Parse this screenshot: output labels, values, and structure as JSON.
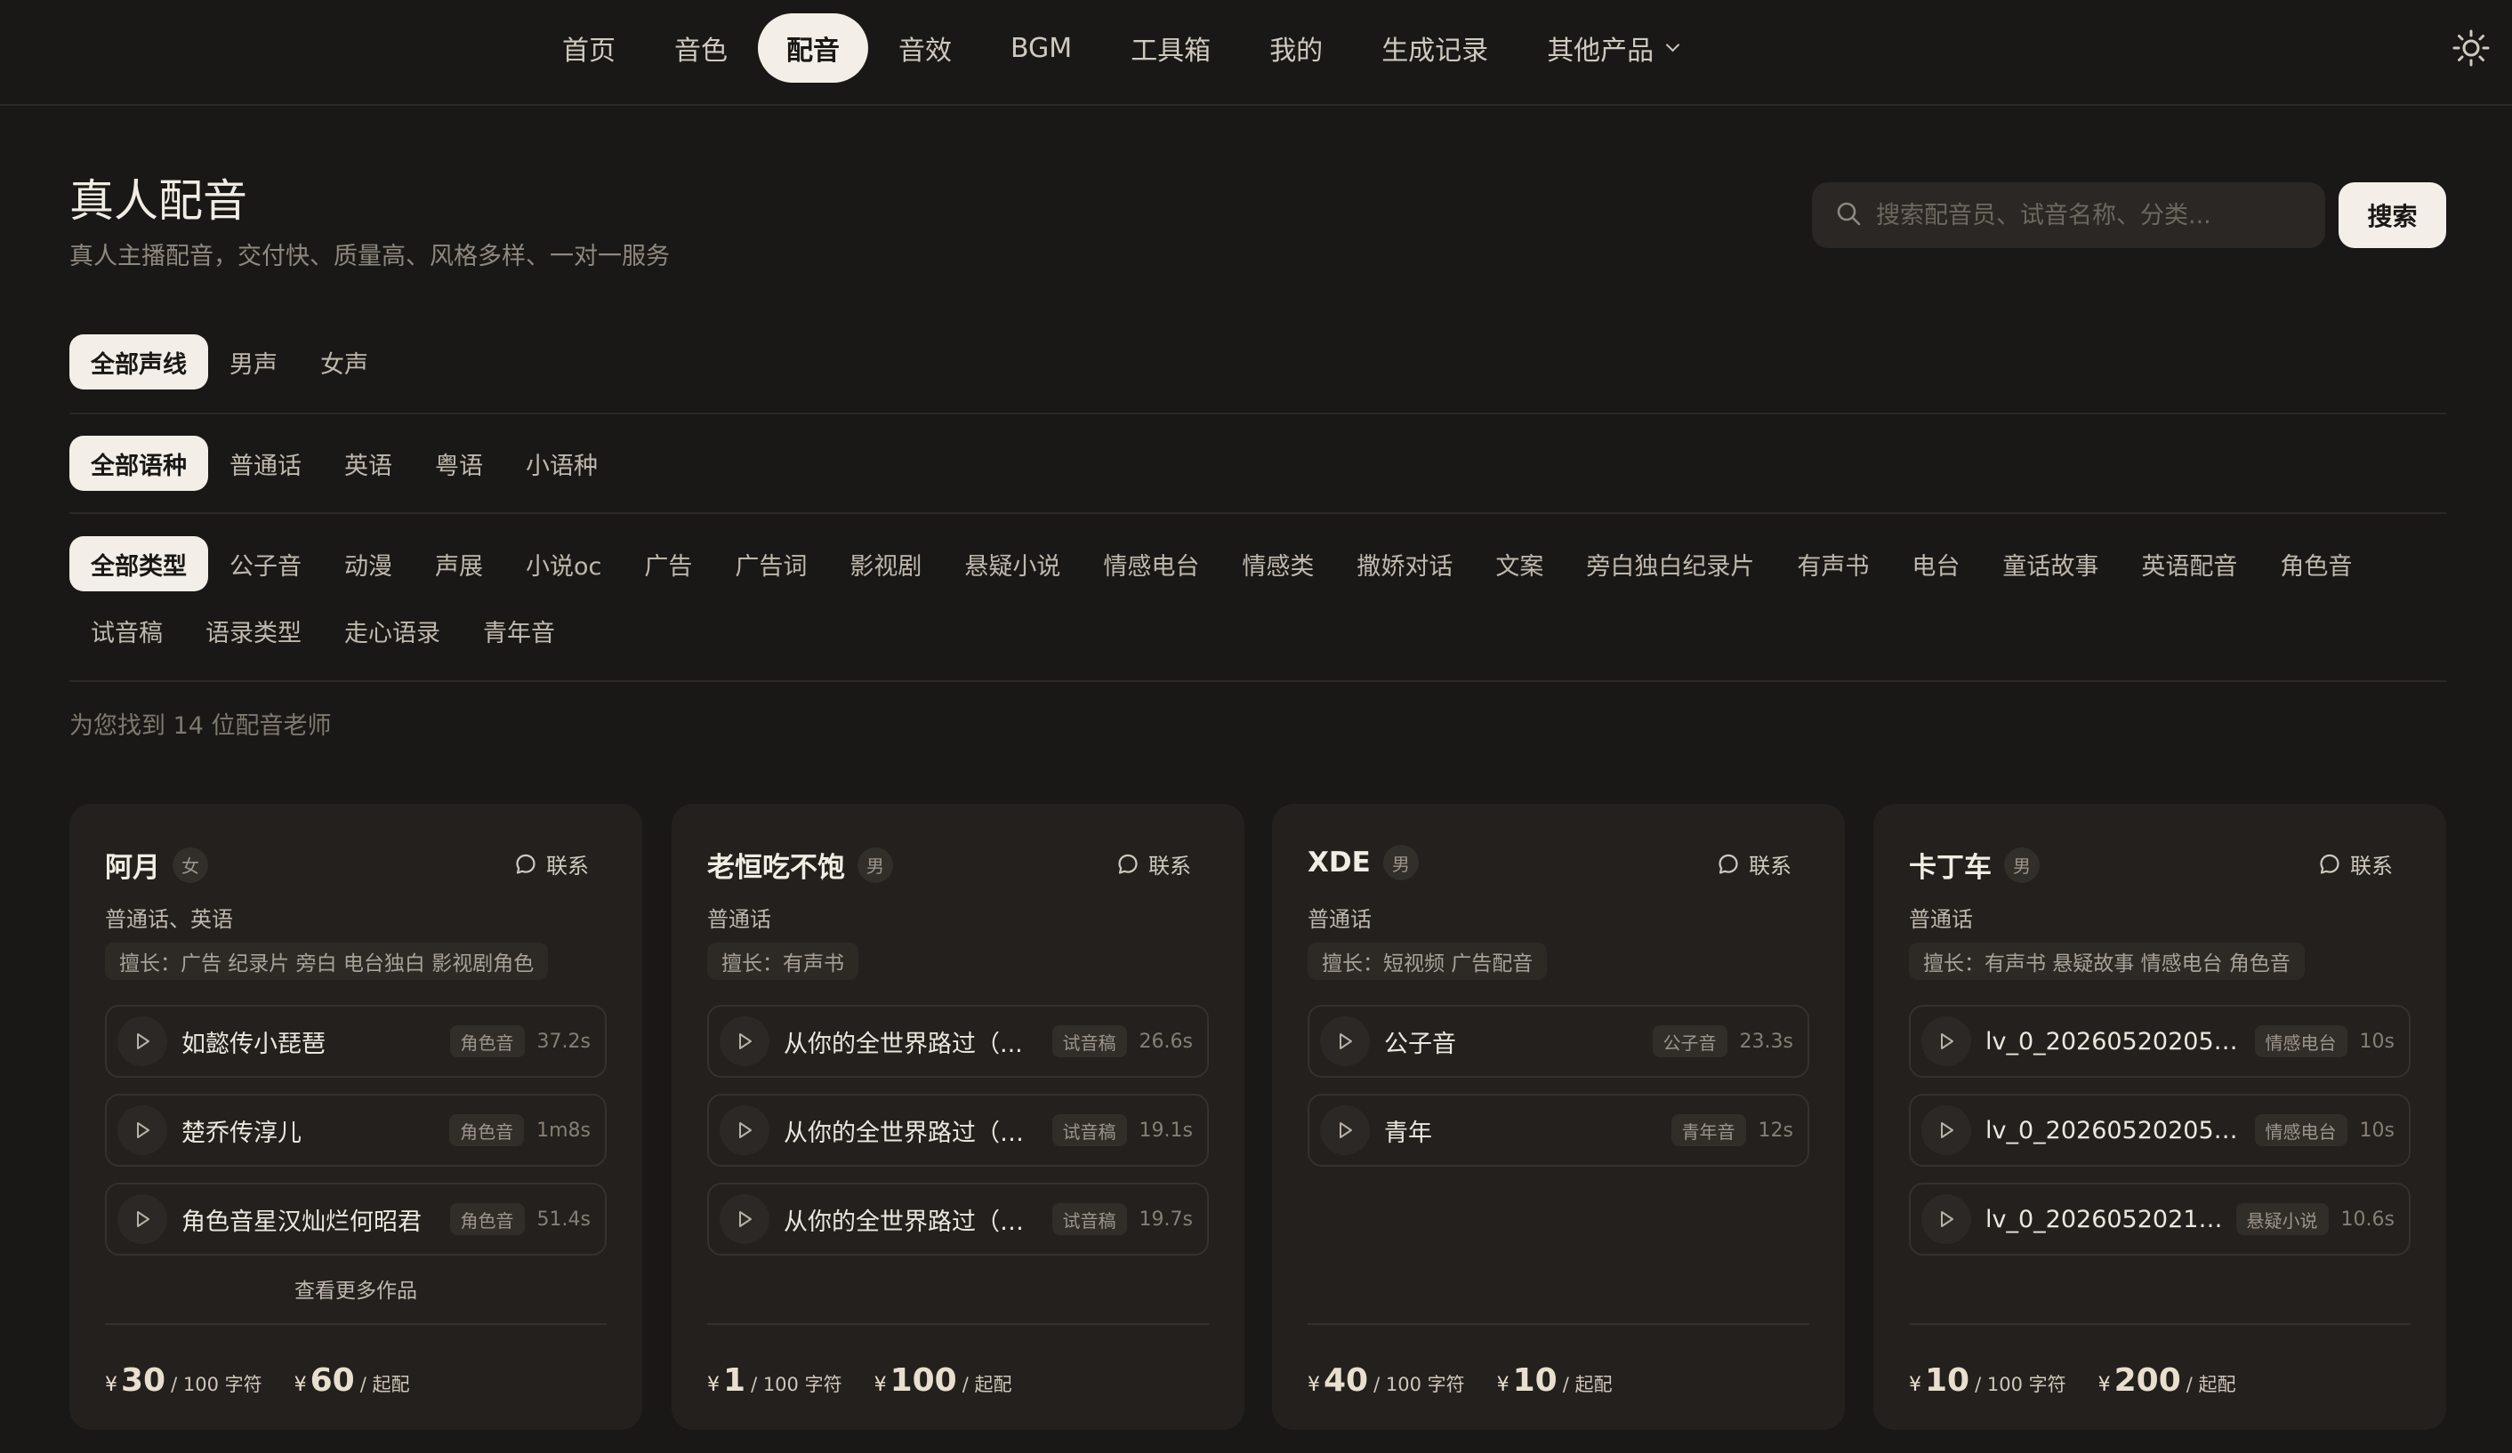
{
  "nav": {
    "items": [
      {
        "label": "首页",
        "active": false
      },
      {
        "label": "音色",
        "active": false
      },
      {
        "label": "配音",
        "active": true
      },
      {
        "label": "音效",
        "active": false
      },
      {
        "label": "BGM",
        "active": false
      },
      {
        "label": "工具箱",
        "active": false
      },
      {
        "label": "我的",
        "active": false
      },
      {
        "label": "生成记录",
        "active": false
      },
      {
        "label": "其他产品",
        "active": false,
        "dropdown": true
      }
    ],
    "theme_icon": "sun-icon"
  },
  "header": {
    "title": "真人配音",
    "subtitle": "真人主播配音，交付快、质量高、风格多样、一对一服务"
  },
  "search": {
    "placeholder": "搜索配音员、试音名称、分类...",
    "button_label": "搜索"
  },
  "filters": {
    "gender": [
      "全部声线",
      "男声",
      "女声"
    ],
    "language": [
      "全部语种",
      "普通话",
      "英语",
      "粤语",
      "小语种"
    ],
    "category": [
      "全部类型",
      "公子音",
      "动漫",
      "声展",
      "小说oc",
      "广告",
      "广告词",
      "影视剧",
      "悬疑小说",
      "情感电台",
      "情感类",
      "撒娇对话",
      "文案",
      "旁白独白纪录片",
      "有声书",
      "电台",
      "童话故事",
      "英语配音",
      "角色音",
      "试音稿",
      "语录类型",
      "走心语录",
      "青年音"
    ]
  },
  "result_count": "为您找到 14 位配音老师",
  "cards": [
    {
      "name": "阿月",
      "gender": "女",
      "contact": "联系",
      "languages": "普通话、英语",
      "specialty": "擅长：广告 纪录片 旁白 电台独白 影视剧角色",
      "tracks": [
        {
          "title": "如懿传小琵琶",
          "tag": "角色音",
          "duration": "37.2s"
        },
        {
          "title": "楚乔传淳儿",
          "tag": "角色音",
          "duration": "1m8s"
        },
        {
          "title": "角色音星汉灿烂何昭君",
          "tag": "角色音",
          "duration": "51.4s"
        }
      ],
      "more": "查看更多作品",
      "prices": [
        {
          "currency": "¥",
          "amount": "30",
          "unit": "/ 100 字符"
        },
        {
          "currency": "¥",
          "amount": "60",
          "unit": "/ 起配"
        }
      ]
    },
    {
      "name": "老恒吃不饱",
      "gender": "男",
      "contact": "联系",
      "languages": "普通话",
      "specialty": "擅长：有声书",
      "tracks": [
        {
          "title": "从你的全世界路过（...",
          "tag": "试音稿",
          "duration": "26.6s"
        },
        {
          "title": "从你的全世界路过（青...",
          "tag": "试音稿",
          "duration": "19.1s"
        },
        {
          "title": "从你的全世界路过（中...",
          "tag": "试音稿",
          "duration": "19.7s"
        }
      ],
      "more": "",
      "prices": [
        {
          "currency": "¥",
          "amount": "1",
          "unit": "/ 100 字符"
        },
        {
          "currency": "¥",
          "amount": "100",
          "unit": "/ 起配"
        }
      ]
    },
    {
      "name": "XDE",
      "gender": "男",
      "contact": "联系",
      "languages": "普通话",
      "specialty": "擅长：短视频 广告配音",
      "tracks": [
        {
          "title": "公子音",
          "tag": "公子音",
          "duration": "23.3s"
        },
        {
          "title": "青年",
          "tag": "青年音",
          "duration": "12s"
        }
      ],
      "more": "",
      "prices": [
        {
          "currency": "¥",
          "amount": "40",
          "unit": "/ 100 字符"
        },
        {
          "currency": "¥",
          "amount": "10",
          "unit": "/ 起配"
        }
      ]
    },
    {
      "name": "卡丁车",
      "gender": "男",
      "contact": "联系",
      "languages": "普通话",
      "specialty": "擅长：有声书 悬疑故事 情感电台 角色音",
      "tracks": [
        {
          "title": "lv_0_202605202059...",
          "tag": "情感电台",
          "duration": "10s"
        },
        {
          "title": "lv_0_202605202059...",
          "tag": "情感电台",
          "duration": "10s"
        },
        {
          "title": "lv_0_20260520210...",
          "tag": "悬疑小说",
          "duration": "10.6s"
        }
      ],
      "more": "",
      "prices": [
        {
          "currency": "¥",
          "amount": "10",
          "unit": "/ 100 字符"
        },
        {
          "currency": "¥",
          "amount": "200",
          "unit": "/ 起配"
        }
      ]
    }
  ]
}
